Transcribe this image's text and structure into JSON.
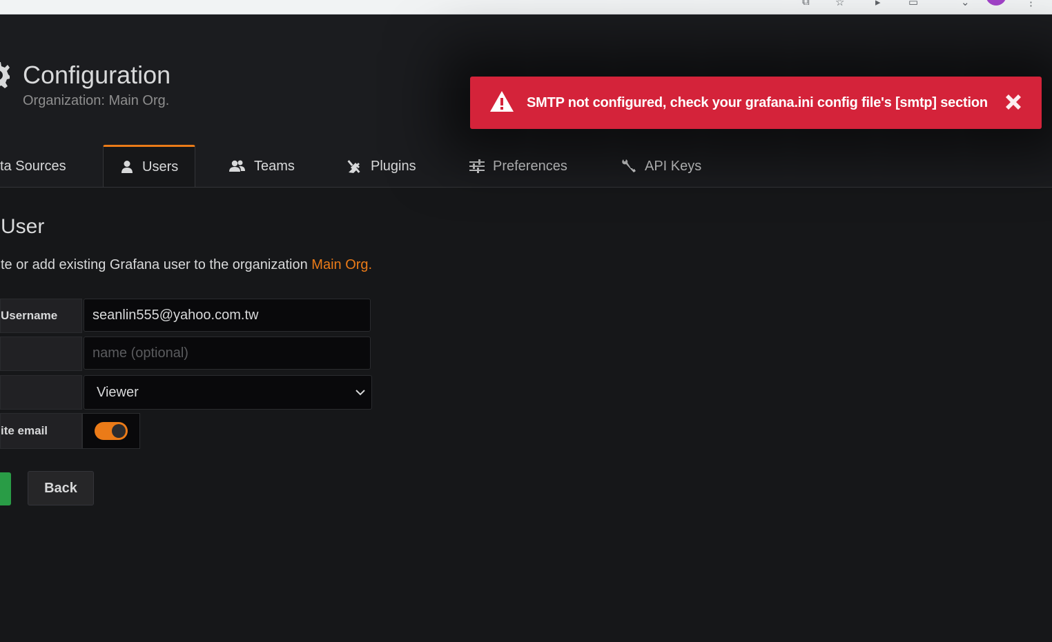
{
  "browser": {
    "url_fragment": "…o.tw:/###:3000/org/users/invite"
  },
  "header": {
    "title": "Configuration",
    "subtitle": "Organization: Main Org."
  },
  "alert": {
    "message": "SMTP not configured, check your grafana.ini config file's [smtp] section",
    "color": "#d4233a"
  },
  "tabs": [
    {
      "label": "ta Sources",
      "icon": "database-icon"
    },
    {
      "label": "Users",
      "icon": "user-icon",
      "active": true
    },
    {
      "label": "Teams",
      "icon": "users-icon"
    },
    {
      "label": "Plugins",
      "icon": "plug-icon"
    },
    {
      "label": "Preferences",
      "icon": "sliders-icon"
    },
    {
      "label": "API Keys",
      "icon": "key-icon"
    }
  ],
  "main": {
    "title": "User",
    "description": "te or add existing Grafana user to the organization ",
    "org_name": "Main Org."
  },
  "form": {
    "username_label": "Username",
    "username_value": "seanlin555@yahoo.com.tw",
    "name_placeholder": "name (optional)",
    "role_value": "Viewer",
    "invite_label": "ite email",
    "invite_enabled": true
  },
  "buttons": {
    "back": "Back"
  },
  "colors": {
    "accent": "#eb7b18",
    "success": "#299c46",
    "background": "#161719"
  }
}
